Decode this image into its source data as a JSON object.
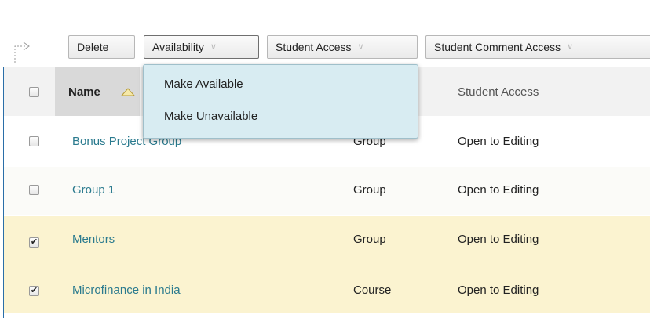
{
  "toolbar": {
    "delete_label": "Delete",
    "availability_label": "Availability",
    "student_access_label": "Student Access",
    "student_comment_access_label": "Student Comment Access"
  },
  "availability_menu": {
    "items": [
      "Make Available",
      "Make Unavailable"
    ]
  },
  "table": {
    "headers": {
      "name": "Name",
      "student_access": "Student Access"
    },
    "rows": [
      {
        "name": "Bonus Project Group",
        "type": "Group",
        "access": "Open to Editing",
        "checked": false
      },
      {
        "name": "Group 1",
        "type": "Group",
        "access": "Open to Editing",
        "checked": false
      },
      {
        "name": "Mentors",
        "type": "Group",
        "access": "Open to Editing",
        "checked": true
      },
      {
        "name": "Microfinance in India",
        "type": "Course",
        "access": "Open to Editing",
        "checked": true
      }
    ]
  },
  "icons": {
    "action_arrow": "bent-arrow-icon",
    "chevron": "double-chevron-down-icon",
    "sort": "sort-ascending-triangle-icon",
    "check": "checkmark-icon"
  },
  "colors": {
    "link": "#2a7a8e",
    "selected_row": "#fbf3d0",
    "menu_bg": "#d8ecf2",
    "frame_border": "#2a6ea8"
  }
}
